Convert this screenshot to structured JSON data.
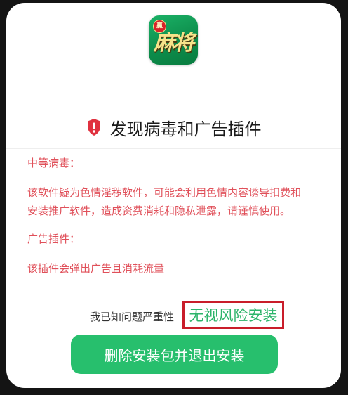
{
  "app": {
    "icon_name": "mahjong-app-icon",
    "icon_text": "麻将",
    "icon_badge": "赢"
  },
  "dialog": {
    "title": "发现病毒和广告插件",
    "warning_icon": "shield-warning-icon",
    "virus_heading": "中等病毒：",
    "virus_desc_line1": "该软件疑为色情淫秽软件，可能会利用色情内容诱导扣费和",
    "virus_desc_line2": "安装推广软件，造成资费消耗和隐私泄露，请谨慎使用。",
    "ad_heading": "广告插件：",
    "ad_desc": "该插件会弹出广告且消耗流量",
    "ack_text": "我已知问题严重性",
    "ignore_risk_label": "无视风险安装",
    "delete_button_label": "删除安装包并退出安装"
  },
  "colors": {
    "warning_red": "#e0505a",
    "shield_red": "#e0313f",
    "accent_green": "#27bf6d",
    "link_green": "#2db46b",
    "highlight_box": "#c91d2a"
  }
}
